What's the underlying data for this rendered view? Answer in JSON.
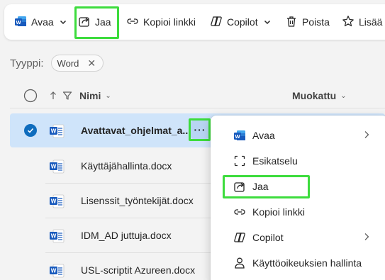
{
  "toolbar": {
    "open_label": "Avaa",
    "share_label": "Jaa",
    "copy_link_label": "Kopioi linkki",
    "copilot_label": "Copilot",
    "delete_label": "Poista",
    "more_label": "Lisää s"
  },
  "filter": {
    "label": "Tyyppi:",
    "chip_label": "Word",
    "chip_remove": "✕"
  },
  "header": {
    "name_label": "Nimi",
    "modified_label": "Muokattu"
  },
  "files": [
    {
      "name": "Avattavat_ohjelmat_a...",
      "selected": true
    },
    {
      "name": "Käyttäjähallinta.docx",
      "selected": false
    },
    {
      "name": "Lisenssit_työntekijät.docx",
      "selected": false
    },
    {
      "name": "IDM_AD juttuja.docx",
      "selected": false
    },
    {
      "name": "USL-scriptit Azureen.docx",
      "selected": false
    }
  ],
  "row_more_label": "···",
  "context_menu": {
    "items": [
      {
        "label": "Avaa",
        "icon": "word-icon",
        "submenu": true
      },
      {
        "label": "Esikatselu",
        "icon": "preview-icon",
        "submenu": false
      },
      {
        "label": "Jaa",
        "icon": "share-icon",
        "submenu": false
      },
      {
        "label": "Kopioi linkki",
        "icon": "link-icon",
        "submenu": false
      },
      {
        "label": "Copilot",
        "icon": "copilot-icon",
        "submenu": true
      },
      {
        "label": "Käyttöoikeuksien hallinta",
        "icon": "person-key-icon",
        "submenu": false
      }
    ]
  },
  "colors": {
    "accent": "#0f6cbd",
    "highlight": "#3ddc3d",
    "selected_row": "#cfe4fa",
    "word_blue": "#185abd"
  }
}
